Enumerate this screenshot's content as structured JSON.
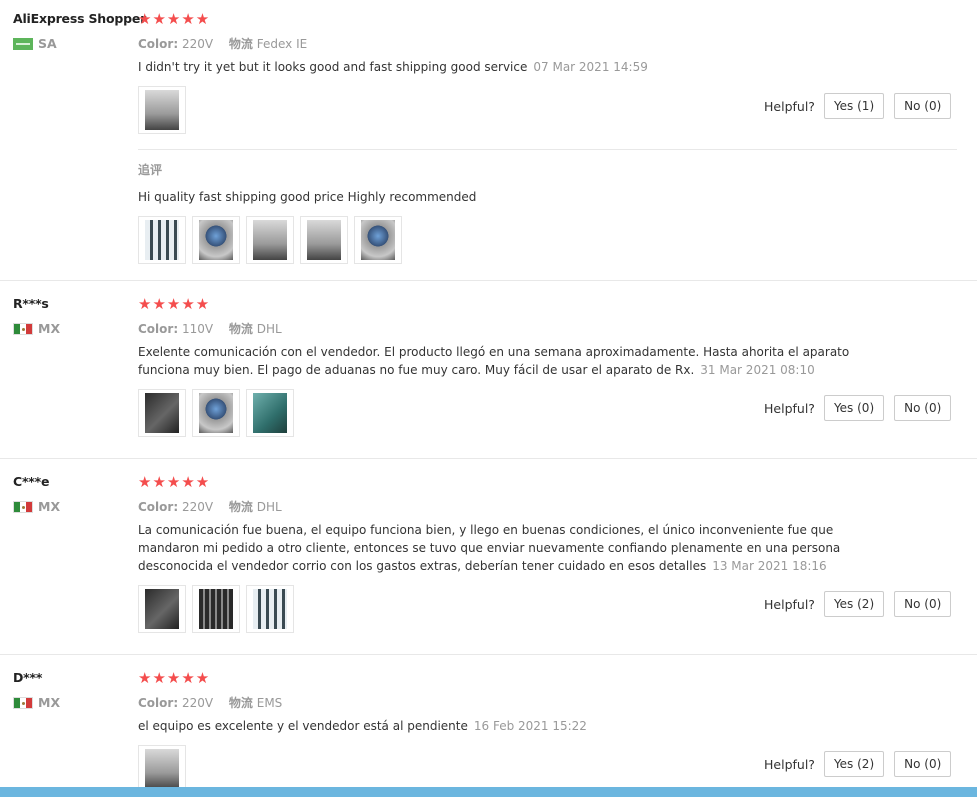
{
  "reviews": [
    {
      "user": "AliExpress Shopper",
      "country": "SA",
      "stars": "★★★★★",
      "color_label": "Color:",
      "color_value": "220V",
      "logistics_label": "物流",
      "logistics_value": "Fedex IE",
      "text": "I didn't try it yet but it looks good and fast shipping good service",
      "date": "07 Mar 2021 14:59",
      "images": 1,
      "helpful_label": "Helpful?",
      "yes": "Yes (1)",
      "no": "No (0)",
      "followup": {
        "title": "追评",
        "text": "Hi quality fast shipping good price Highly recommended",
        "images": 5
      }
    },
    {
      "user": "R***s",
      "country": "MX",
      "stars": "★★★★★",
      "color_label": "Color:",
      "color_value": "110V",
      "logistics_label": "物流",
      "logistics_value": "DHL",
      "text": "Exelente comunicación con el vendedor. El producto llegó en una semana aproximadamente. Hasta ahorita el aparato funciona muy bien. El pago de aduanas no fue muy caro. Muy fácil de usar el aparato de Rx.",
      "date": "31 Mar 2021 08:10",
      "images": 3,
      "helpful_label": "Helpful?",
      "yes": "Yes (0)",
      "no": "No (0)"
    },
    {
      "user": "C***e",
      "country": "MX",
      "stars": "★★★★★",
      "color_label": "Color:",
      "color_value": "220V",
      "logistics_label": "物流",
      "logistics_value": "DHL",
      "text": "La comunicación fue buena, el equipo funciona bien, y llego en buenas condiciones, el único inconveniente fue que mandaron mi pedido a otro cliente, entonces se tuvo que enviar nuevamente confiando plenamente en una persona desconocida el vendedor corrio con los gastos extras, deberían tener cuidado en esos detalles",
      "date": "13 Mar 2021 18:16",
      "images": 3,
      "helpful_label": "Helpful?",
      "yes": "Yes (2)",
      "no": "No (0)"
    },
    {
      "user": "D***",
      "country": "MX",
      "stars": "★★★★★",
      "color_label": "Color:",
      "color_value": "220V",
      "logistics_label": "物流",
      "logistics_value": "EMS",
      "text": "el equipo es excelente y el vendedor está al pendiente",
      "date": "16 Feb 2021 15:22",
      "images": 1,
      "helpful_label": "Helpful?",
      "yes": "Yes (2)",
      "no": "No (0)"
    }
  ],
  "colors": {
    "star": "#f44d4d",
    "muted": "#999999",
    "text": "#333333",
    "border": "#cccccc",
    "bottom_bar": "#6bb6df"
  }
}
